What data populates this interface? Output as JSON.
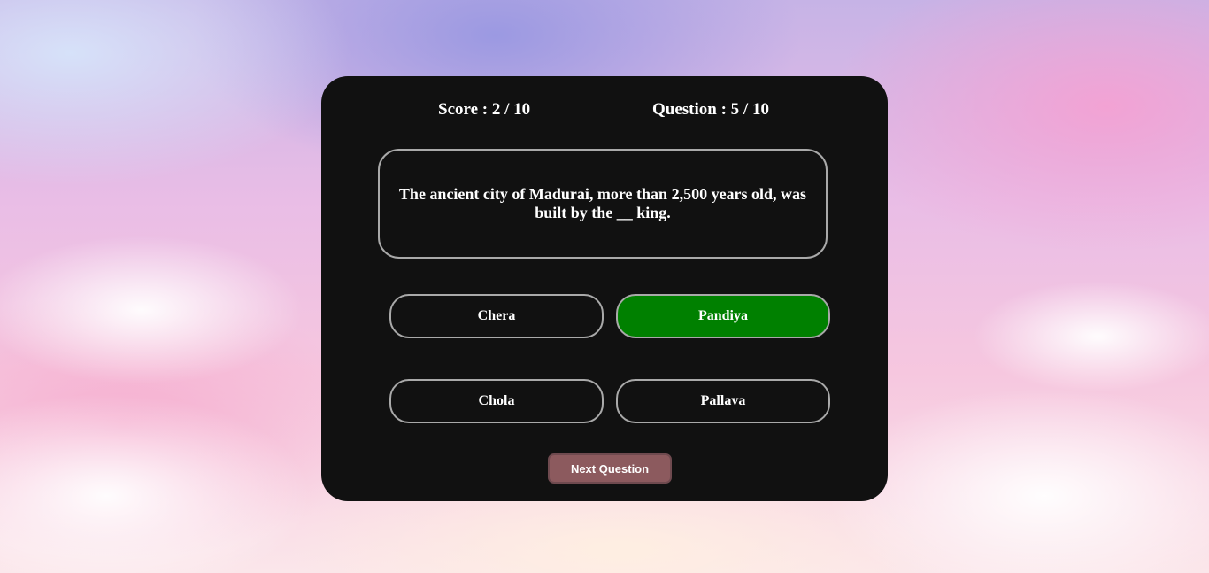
{
  "header": {
    "score_text": "Score : 2 / 10",
    "question_counter_text": "Question : 5 / 10"
  },
  "question": {
    "text": "The ancient city of Madurai, more than 2,500 years old, was built by the __ king."
  },
  "options": [
    {
      "label": "Chera",
      "state": "default"
    },
    {
      "label": "Pandiya",
      "state": "correct"
    },
    {
      "label": "Chola",
      "state": "default"
    },
    {
      "label": "Pallava",
      "state": "default"
    }
  ],
  "next_button": {
    "label": "Next Question"
  },
  "colors": {
    "card_background": "#111111",
    "correct_answer": "#008000",
    "option_border": "#a9a9a9",
    "next_button": "#8c5a5e"
  }
}
